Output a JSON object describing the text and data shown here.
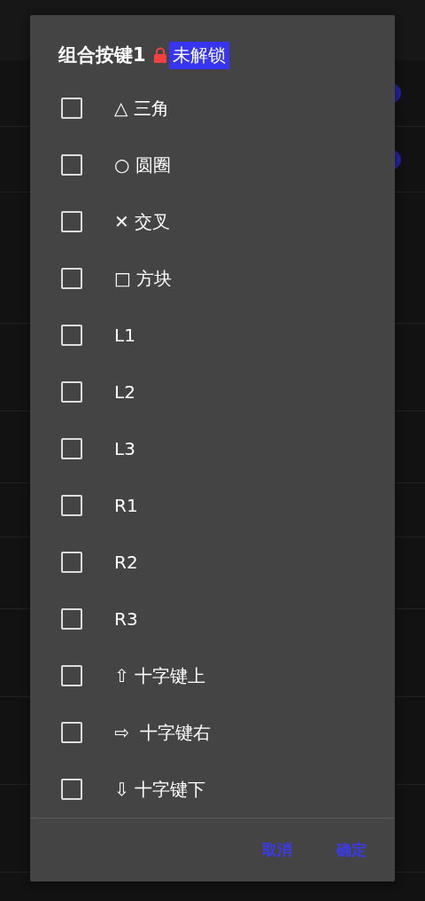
{
  "background_toggles": [
    {
      "on": true
    },
    {
      "on": true
    }
  ],
  "dialog": {
    "title": "组合按键1",
    "locked": true,
    "lock_badge": "未解锁",
    "options": [
      {
        "label": "△ 三角",
        "checked": false
      },
      {
        "label": "○ 圆圈",
        "checked": false
      },
      {
        "label": "✕ 交叉",
        "checked": false
      },
      {
        "label": "□ 方块",
        "checked": false
      },
      {
        "label": "L1",
        "checked": false
      },
      {
        "label": "L2",
        "checked": false
      },
      {
        "label": "L3",
        "checked": false
      },
      {
        "label": "R1",
        "checked": false
      },
      {
        "label": "R2",
        "checked": false
      },
      {
        "label": "R3",
        "checked": false
      },
      {
        "label": "⇧ 十字键上",
        "checked": false
      },
      {
        "label": "⇨  十字键右",
        "checked": false
      },
      {
        "label": "⇩ 十字键下",
        "checked": false
      }
    ],
    "buttons": [
      "取消",
      "确定"
    ]
  }
}
